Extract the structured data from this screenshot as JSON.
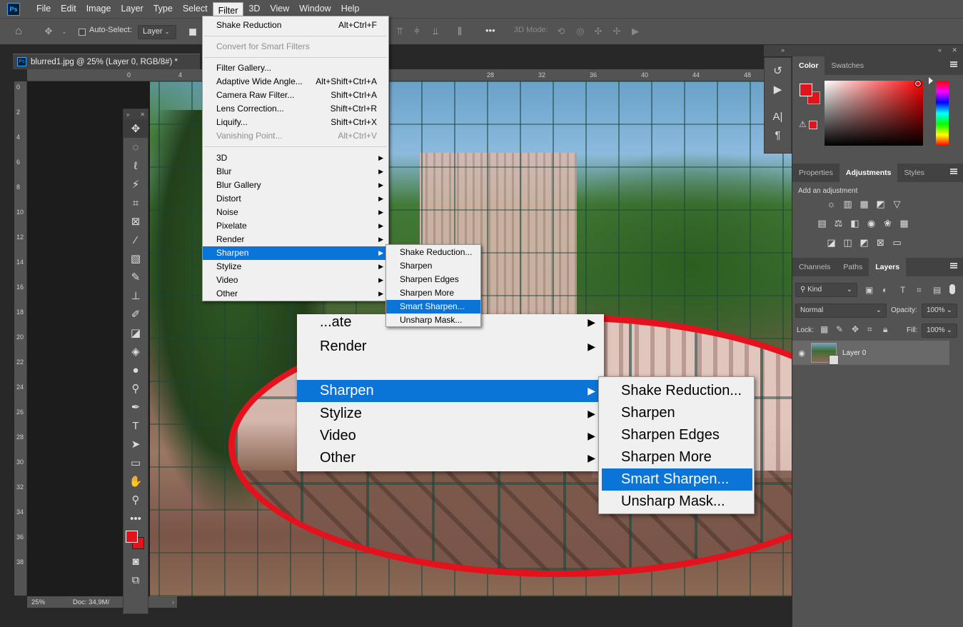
{
  "app": {
    "logo": "Ps",
    "menubar": [
      "File",
      "Edit",
      "Image",
      "Layer",
      "Type",
      "Select",
      "Filter",
      "3D",
      "View",
      "Window",
      "Help"
    ],
    "active_menu": "Filter"
  },
  "options_bar": {
    "auto_select_label": "Auto-Select:",
    "auto_select_target": "Layer",
    "mode_3d_label": "3D Mode:",
    "more_label": "•••"
  },
  "document": {
    "tab_title": "blurred1.jpg @ 25% (Layer 0, RGB/8#) *",
    "zoom": "25%",
    "doc_info": "Doc: 34,9M/"
  },
  "rulers": {
    "h_ticks": [
      "0",
      "4",
      "28",
      "32",
      "36",
      "40",
      "44",
      "48"
    ],
    "v_ticks": [
      "0",
      "2",
      "4",
      "6",
      "8",
      "1 0",
      "1 2",
      "1 4",
      "1 6",
      "1 8",
      "2 0",
      "2 2",
      "2 4",
      "2 6",
      "2 8",
      "3 0",
      "3 2",
      "3 4",
      "3 6",
      "3 8"
    ]
  },
  "filter_menu": {
    "items": [
      {
        "label": "Shake Reduction",
        "shortcut": "Alt+Ctrl+F",
        "disabled": false
      },
      {
        "label": "Convert for Smart Filters",
        "shortcut": "",
        "disabled": true
      },
      {
        "label": "Filter Gallery...",
        "shortcut": "",
        "disabled": false
      },
      {
        "label": "Adaptive Wide Angle...",
        "shortcut": "Alt+Shift+Ctrl+A",
        "disabled": false
      },
      {
        "label": "Camera Raw Filter...",
        "shortcut": "Shift+Ctrl+A",
        "disabled": false
      },
      {
        "label": "Lens Correction...",
        "shortcut": "Shift+Ctrl+R",
        "disabled": false
      },
      {
        "label": "Liquify...",
        "shortcut": "Shift+Ctrl+X",
        "disabled": false
      },
      {
        "label": "Vanishing Point...",
        "shortcut": "Alt+Ctrl+V",
        "disabled": true
      },
      {
        "label": "3D",
        "shortcut": "",
        "disabled": false
      },
      {
        "label": "Blur",
        "shortcut": "",
        "disabled": false
      },
      {
        "label": "Blur Gallery",
        "shortcut": "",
        "disabled": false
      },
      {
        "label": "Distort",
        "shortcut": "",
        "disabled": false
      },
      {
        "label": "Noise",
        "shortcut": "",
        "disabled": false
      },
      {
        "label": "Pixelate",
        "shortcut": "",
        "disabled": false
      },
      {
        "label": "Render",
        "shortcut": "",
        "disabled": false
      },
      {
        "label": "Sharpen",
        "shortcut": "",
        "disabled": false
      },
      {
        "label": "Stylize",
        "shortcut": "",
        "disabled": false
      },
      {
        "label": "Video",
        "shortcut": "",
        "disabled": false
      },
      {
        "label": "Other",
        "shortcut": "",
        "disabled": false
      }
    ],
    "highlighted": "Sharpen"
  },
  "sharpen_submenu": {
    "items": [
      "Shake Reduction...",
      "Sharpen",
      "Sharpen Edges",
      "Sharpen More",
      "Smart Sharpen...",
      "Unsharp Mask..."
    ],
    "highlighted": "Smart Sharpen..."
  },
  "zoom_callout": {
    "main_items": [
      "Render",
      "Sharpen",
      "Stylize",
      "Video",
      "Other"
    ],
    "partial_item": "...ate",
    "sub_items": [
      "Shake Reduction...",
      "Sharpen",
      "Sharpen Edges",
      "Sharpen More",
      "Smart Sharpen...",
      "Unsharp Mask..."
    ],
    "highlight_color": "#0a74d8",
    "ellipse_color": "#e4121c"
  },
  "color_panel": {
    "tabs": [
      "Color",
      "Swatches"
    ],
    "active_tab": "Color",
    "foreground": "#e0141b",
    "background": "#e0141b"
  },
  "adjustments_panel": {
    "tabs": [
      "Properties",
      "Adjustments",
      "Styles"
    ],
    "active_tab": "Adjustments",
    "hint": "Add an adjustment"
  },
  "layers_panel": {
    "tabs": [
      "Channels",
      "Paths",
      "Layers"
    ],
    "active_tab": "Layers",
    "filter_kind": "Kind",
    "blend_mode": "Normal",
    "opacity_label": "Opacity:",
    "opacity": "100%",
    "lock_label": "Lock:",
    "fill_label": "Fill:",
    "fill": "100%",
    "layers": [
      {
        "name": "Layer 0",
        "visible": true
      }
    ]
  }
}
